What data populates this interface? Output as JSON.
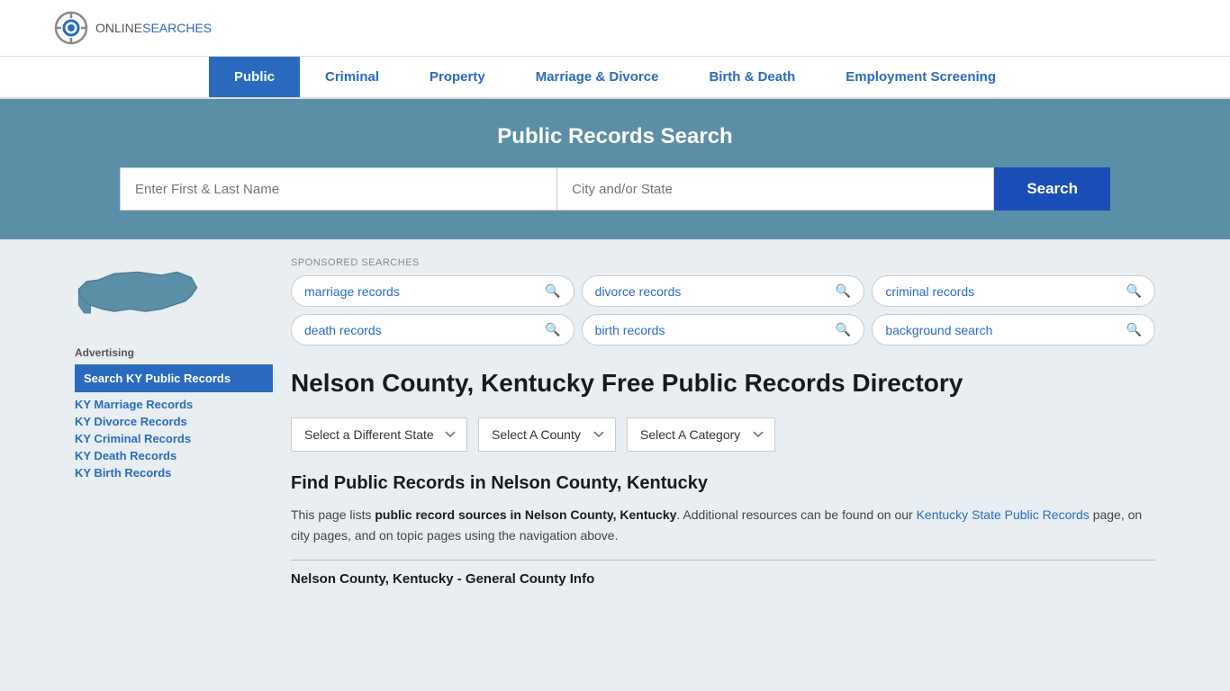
{
  "site": {
    "logo_online": "ONLINE",
    "logo_searches": "SEARCHES"
  },
  "nav": {
    "items": [
      {
        "label": "Public",
        "active": true
      },
      {
        "label": "Criminal",
        "active": false
      },
      {
        "label": "Property",
        "active": false
      },
      {
        "label": "Marriage & Divorce",
        "active": false
      },
      {
        "label": "Birth & Death",
        "active": false
      },
      {
        "label": "Employment Screening",
        "active": false
      }
    ]
  },
  "hero": {
    "title": "Public Records Search",
    "name_placeholder": "Enter First & Last Name",
    "location_placeholder": "City and/or State",
    "search_button": "Search"
  },
  "sponsored": {
    "label": "SPONSORED SEARCHES",
    "pills": [
      {
        "label": "marriage records"
      },
      {
        "label": "divorce records"
      },
      {
        "label": "criminal records"
      },
      {
        "label": "death records"
      },
      {
        "label": "birth records"
      },
      {
        "label": "background search"
      }
    ]
  },
  "page": {
    "title": "Nelson County, Kentucky Free Public Records Directory",
    "state_dropdown": "Select a Different State",
    "county_dropdown": "Select A County",
    "category_dropdown": "Select A Category",
    "find_title": "Find Public Records in Nelson County, Kentucky",
    "find_desc_1": "This page lists ",
    "find_desc_bold": "public record sources in Nelson County, Kentucky",
    "find_desc_2": ". Additional resources can be found on our ",
    "find_desc_link": "Kentucky State Public Records",
    "find_desc_3": " page, on city pages, and on topic pages using the navigation above.",
    "bottom_section_title": "Nelson County, Kentucky - General County Info"
  },
  "sidebar": {
    "advertising_label": "Advertising",
    "highlight_link": "Search KY Public Records",
    "links": [
      {
        "label": "KY Marriage Records"
      },
      {
        "label": "KY Divorce Records"
      },
      {
        "label": "KY Criminal Records"
      },
      {
        "label": "KY Death Records"
      },
      {
        "label": "KY Birth Records"
      }
    ]
  }
}
